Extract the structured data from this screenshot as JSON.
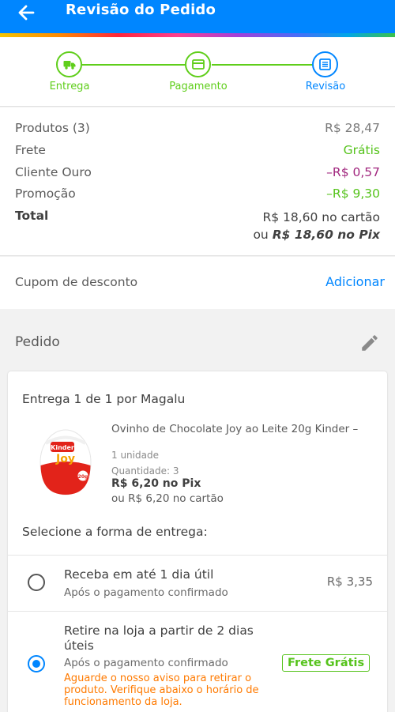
{
  "header": {
    "title": "Revisão do Pedido",
    "back_icon": "arrow-left-icon"
  },
  "steps": [
    {
      "label": "Entrega",
      "icon": "truck-icon",
      "status": "done"
    },
    {
      "label": "Pagamento",
      "icon": "credit-card-icon",
      "status": "done"
    },
    {
      "label": "Revisão",
      "icon": "document-icon",
      "status": "active"
    }
  ],
  "summary": {
    "products_label": "Produtos (3)",
    "products_value": "R$ 28,47",
    "shipping_label": "Frete",
    "shipping_value": "Grátis",
    "client_label": "Cliente Ouro",
    "client_value": "–R$ 0,57",
    "promo_label": "Promoção",
    "promo_value": "–R$ 9,30",
    "total_label": "Total",
    "total_card": "R$ 18,60 no cartão",
    "total_or": "ou",
    "total_pix": "R$ 18,60 no Pix"
  },
  "coupon": {
    "label": "Cupom de desconto",
    "action": "Adicionar"
  },
  "order": {
    "title": "Pedido",
    "edit_icon": "pencil-icon",
    "delivery_title": "Entrega 1 de 1 por Magalu",
    "product": {
      "name": "Ovinho de Chocolate Joy ao Leite 20g Kinder –",
      "unit": "1 unidade",
      "quantity": "Quantidade:  3",
      "price_pix": "R$ 6,20 no Pix",
      "price_card": "ou R$ 6,20 no cartão",
      "image_brand": "Kinder",
      "image_sub": "Joy",
      "image_weight": "20g"
    },
    "delivery_prompt": "Selecione a forma de entrega:",
    "options": [
      {
        "title": "Receba em até 1 dia útil",
        "subtitle": "Após o pagamento confirmado",
        "price": "R$ 3,35",
        "selected": false
      },
      {
        "title_line1": "Retire na loja a partir de 2 dias",
        "title_line2": "úteis",
        "subtitle": "Após o pagamento confirmado",
        "badge": "Frete Grátis",
        "warning": "Aguarde o nosso aviso para retirar o produto. Verifique abaixo o horário de funcionamento da loja.",
        "selected": true
      }
    ]
  },
  "colors": {
    "primary": "#0086ff",
    "success": "#5fce1a",
    "discount_purple": "#a1267e",
    "warning_orange": "#ff7a00"
  }
}
